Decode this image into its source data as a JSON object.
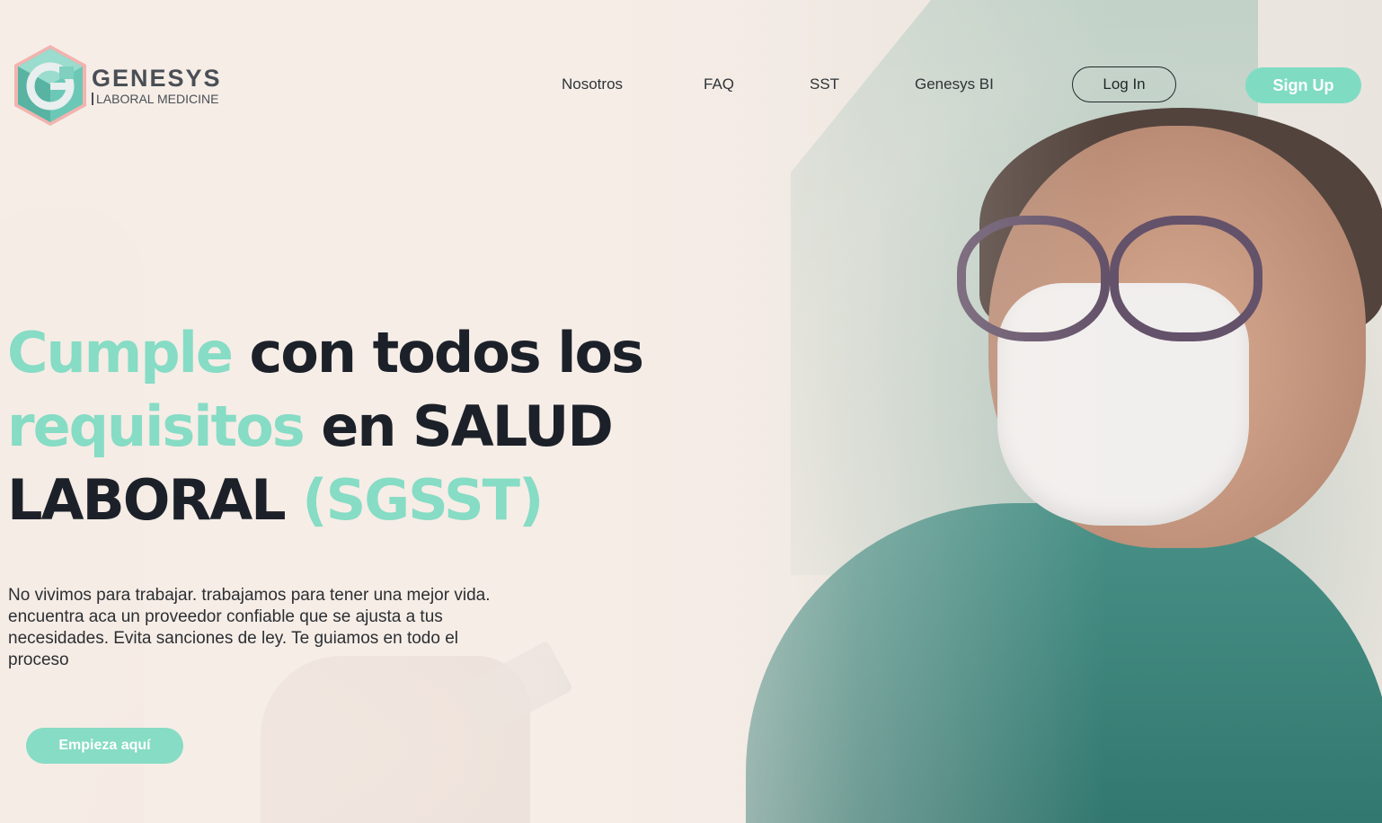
{
  "brand": {
    "name": "GENESYS",
    "tagline": "LABORAL MEDICINE",
    "logo_icon": "genesys-hexagon-g-icon",
    "colors": {
      "accent": "#86dcc4",
      "dark": "#1c2129",
      "logo_teal": "#5fbfae",
      "logo_pink": "#f2a8a8"
    }
  },
  "nav": {
    "items": [
      {
        "label": "Nosotros"
      },
      {
        "label": "FAQ"
      },
      {
        "label": "SST"
      },
      {
        "label": "Genesys BI"
      }
    ],
    "login_label": "Log In",
    "signup_label": "Sign Up"
  },
  "hero": {
    "headline": {
      "accent_1": "Cumple",
      "text_1": " con todos los ",
      "accent_2": "requisitos",
      "text_2": " en SALUD LABORAL ",
      "accent_3": "(SGSST)"
    },
    "description": "No vivimos para trabajar. trabajamos para tener una mejor vida. encuentra aca un proveedor confiable que se ajusta a tus necesidades. Evita sanciones de ley. Te guiamos en todo el proceso",
    "cta_label": "Empieza aquí"
  }
}
